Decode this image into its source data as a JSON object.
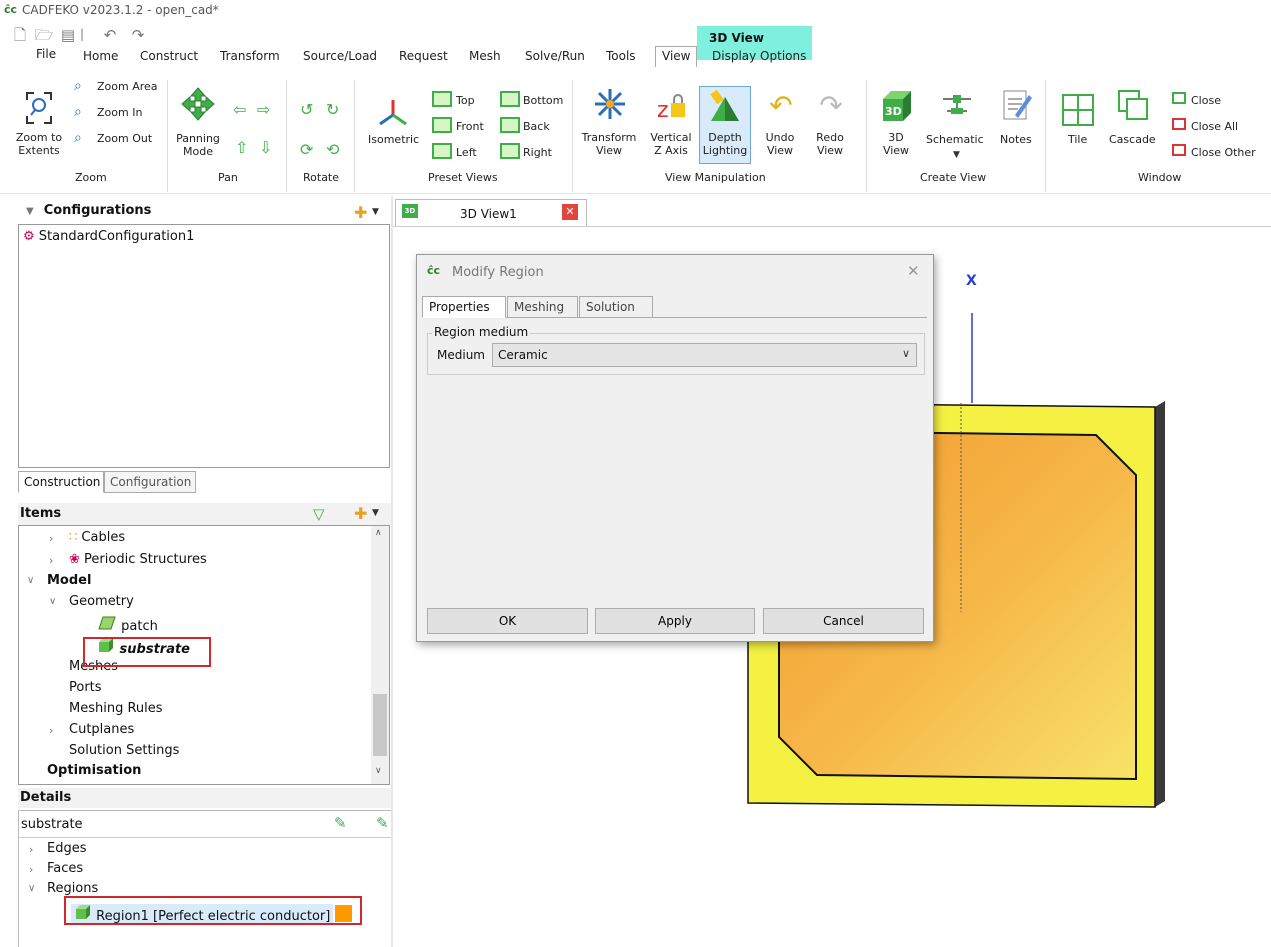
{
  "window": {
    "title": "CADFEKO v2023.1.2 - open_cad*",
    "logo_text": "ĉc"
  },
  "context_tab": "3D View",
  "menu": [
    "File",
    "Home",
    "Construct",
    "Transform",
    "Source/Load",
    "Request",
    "Mesh",
    "Solve/Run",
    "Tools",
    "View",
    "Display Options"
  ],
  "ribbon": {
    "zoom": {
      "extents": "Zoom to\nExtents",
      "area": "Zoom Area",
      "in": "Zoom In",
      "out": "Zoom Out",
      "group": "Zoom"
    },
    "pan": {
      "mode": "Panning\nMode",
      "group": "Pan"
    },
    "rotate": {
      "group": "Rotate"
    },
    "preset": {
      "isometric": "Isometric",
      "top": "Top",
      "bottom": "Bottom",
      "front": "Front",
      "back": "Back",
      "left": "Left",
      "right": "Right",
      "group": "Preset Views"
    },
    "manip": {
      "transform": "Transform\nView",
      "vertical": "Vertical\nZ Axis",
      "depth": "Depth\nLighting",
      "undo": "Undo\nView",
      "redo": "Redo\nView",
      "group": "View Manipulation"
    },
    "create": {
      "view3d": "3D\nView",
      "schematic": "Schematic",
      "notes": "Notes",
      "group": "Create View"
    },
    "window": {
      "tile": "Tile",
      "cascade": "Cascade",
      "close": "Close",
      "close_all": "Close  All",
      "close_other": "Close Other",
      "group": "Window"
    }
  },
  "configurations": {
    "title": "Configurations",
    "items": [
      "StandardConfiguration1"
    ]
  },
  "left_tabs": [
    "Construction",
    "Configuration"
  ],
  "items": {
    "title": "Items",
    "cables": "Cables",
    "periodic": "Periodic Structures",
    "model": "Model",
    "geometry": "Geometry",
    "patch": "patch",
    "substrate": "substrate",
    "meshes": "Meshes",
    "ports": "Ports",
    "meshing_rules": "Meshing Rules",
    "cutplanes": "Cutplanes",
    "solution_settings": "Solution Settings",
    "optimisation": "Optimisation"
  },
  "details": {
    "title": "Details",
    "object": "substrate",
    "edges": "Edges",
    "faces": "Faces",
    "regions": "Regions",
    "region1": "Region1 [Perfect electric conductor]",
    "region_color": "#ff9900"
  },
  "view_tab": {
    "label": "3D View1"
  },
  "axis_label": "X",
  "dialog": {
    "title": "Modify Region",
    "tabs": [
      "Properties",
      "Meshing",
      "Solution"
    ],
    "group_label": "Region medium",
    "medium_label": "Medium",
    "medium_value": "Ceramic",
    "ok": "OK",
    "apply": "Apply",
    "cancel": "Cancel"
  },
  "colors": {
    "accent_tab": "#7ff0de",
    "highlight": "#d0282c",
    "substrate": "#f5f542",
    "patch": "#f5a623"
  }
}
